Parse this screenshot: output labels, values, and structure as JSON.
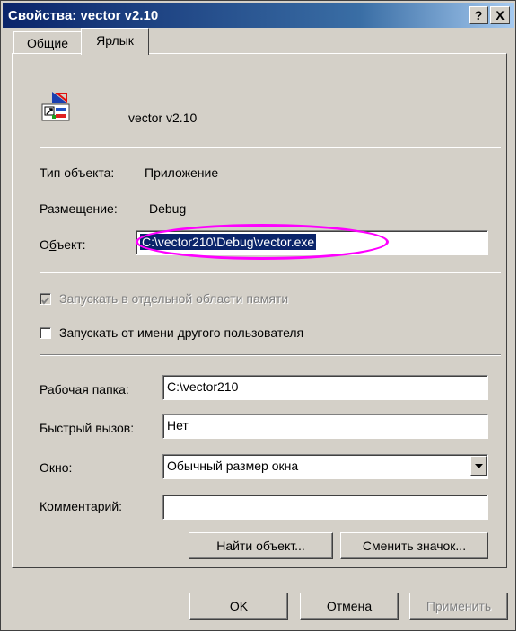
{
  "window": {
    "title": "Свойства: vector v2.10",
    "help_btn": "?",
    "close_btn": "X"
  },
  "tabs": [
    {
      "label": "Общие",
      "active": false
    },
    {
      "label": "Ярлык",
      "active": true
    }
  ],
  "shortcut": {
    "name": "vector v2.10",
    "type_label": "Тип объекта:",
    "type_value": "Приложение",
    "location_label": "Размещение:",
    "location_value": "Debug",
    "target_label": "Объект:",
    "target_value": "C:\\vector210\\Debug\\vector.exe",
    "run_separate_memory": "Запускать в отдельной области памяти",
    "run_as_other_user": "Запускать от имени другого пользователя",
    "workdir_label": "Рабочая папка:",
    "workdir_value": "C:\\vector210",
    "hotkey_label": "Быстрый вызов:",
    "hotkey_value": "Нет",
    "window_label": "Окно:",
    "window_value": "Обычный размер окна",
    "comment_label": "Комментарий:",
    "comment_value": "",
    "find_target_button": "Найти объект...",
    "change_icon_button": "Сменить значок..."
  },
  "footer": {
    "ok": "OK",
    "cancel": "Отмена",
    "apply": "Применить"
  },
  "colors": {
    "highlight_ellipse": "#ff00ff",
    "selection": "#0a246a"
  }
}
